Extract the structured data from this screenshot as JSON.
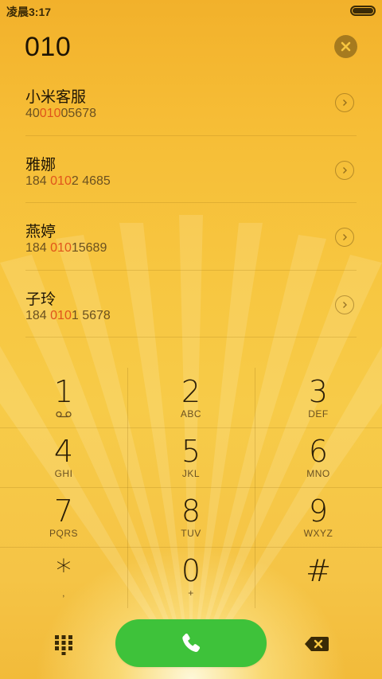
{
  "status_bar": {
    "time": "凌晨3:17"
  },
  "dialer": {
    "input_value": "010"
  },
  "results": [
    {
      "name": "小米客服",
      "number_pre": "40",
      "number_match": "010",
      "number_post": "05678"
    },
    {
      "name": "雅娜",
      "number_pre": "184 ",
      "number_match": "010",
      "number_post": "2 4685"
    },
    {
      "name": "燕婷",
      "number_pre": "184 ",
      "number_match": "010",
      "number_post": "15689"
    },
    {
      "name": "子玲",
      "number_pre": "184 ",
      "number_match": "010",
      "number_post": "1 5678"
    }
  ],
  "keypad": {
    "keys": [
      {
        "digit": "1",
        "letters": ""
      },
      {
        "digit": "2",
        "letters": "ABC"
      },
      {
        "digit": "3",
        "letters": "DEF"
      },
      {
        "digit": "4",
        "letters": "GHI"
      },
      {
        "digit": "5",
        "letters": "JKL"
      },
      {
        "digit": "6",
        "letters": "MNO"
      },
      {
        "digit": "7",
        "letters": "PQRS"
      },
      {
        "digit": "8",
        "letters": "TUV"
      },
      {
        "digit": "9",
        "letters": "WXYZ"
      },
      {
        "digit": "*",
        "letters": ","
      },
      {
        "digit": "0",
        "letters": "+"
      },
      {
        "digit": "#",
        "letters": ""
      }
    ]
  },
  "icons": {
    "clear": "close-icon",
    "result_arrow": "chevron-right-icon",
    "voicemail": "voicemail-icon",
    "dialpad": "dialpad-icon",
    "call": "phone-icon",
    "backspace": "backspace-icon"
  },
  "colors": {
    "highlight": "#e0541b",
    "call_button": "#3ec23a",
    "background": "#f7c640"
  }
}
